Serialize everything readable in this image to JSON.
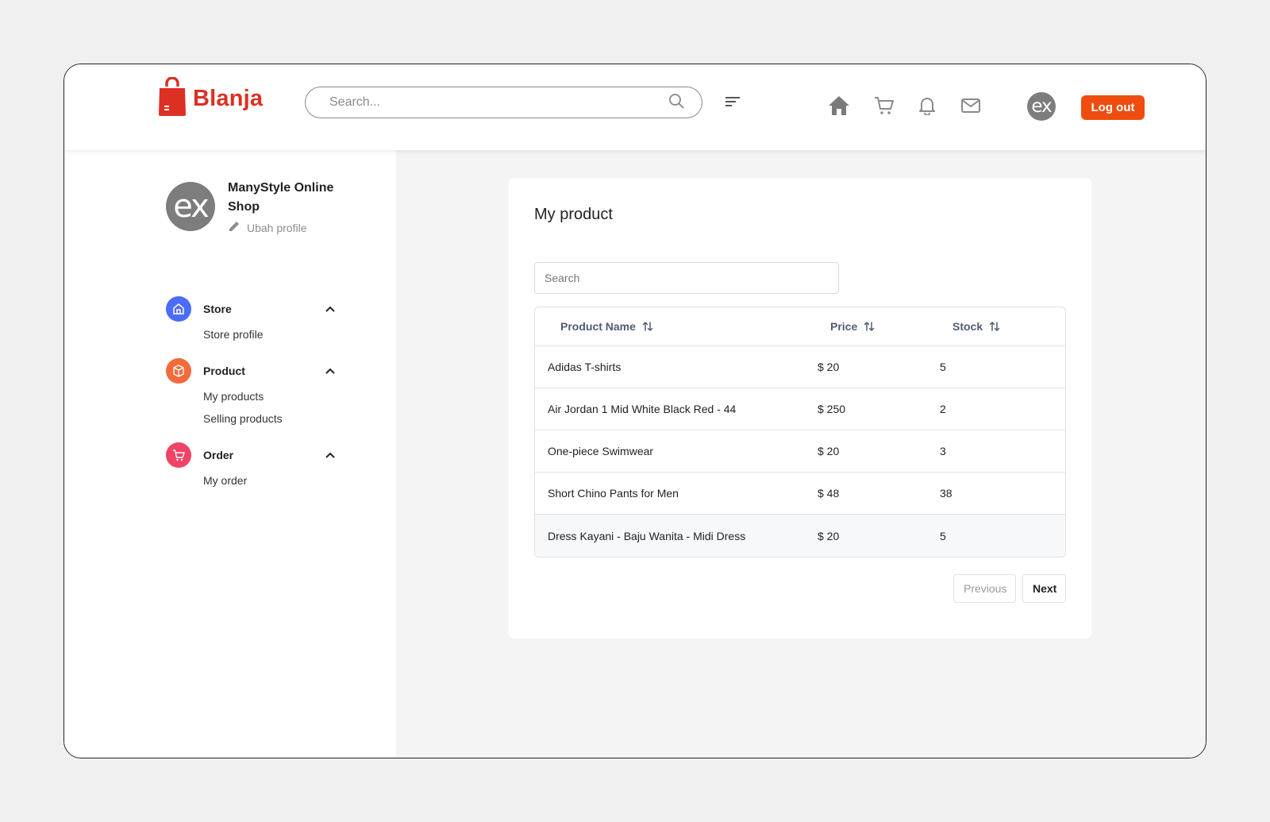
{
  "header": {
    "brand": "Blanja",
    "search_placeholder": "Search...",
    "avatar_text": "ex",
    "logout_label": "Log out",
    "icons": [
      "home-icon",
      "cart-icon",
      "bell-icon",
      "mail-icon"
    ],
    "accent_color": "#db3022",
    "logout_color": "#ee4d0f"
  },
  "sidebar": {
    "avatar_text": "ex",
    "shop_name": "ManyStyle Online Shop",
    "edit_profile_label": "Ubah profile",
    "menu": [
      {
        "label": "Store",
        "icon": "store-icon",
        "color": "#4a6cf7",
        "items": [
          "Store profile"
        ]
      },
      {
        "label": "Product",
        "icon": "box-icon",
        "color": "#f36b3b",
        "items": [
          "My products",
          "Selling products"
        ]
      },
      {
        "label": "Order",
        "icon": "cart-icon",
        "color": "#f04365",
        "items": [
          "My order"
        ]
      }
    ]
  },
  "main": {
    "title": "My product",
    "search_placeholder": "Search",
    "table": {
      "columns": [
        "Product Name",
        "Price",
        "Stock"
      ],
      "rows": [
        {
          "name": "Adidas T-shirts",
          "price": "$ 20",
          "stock": "5"
        },
        {
          "name": "Air Jordan 1 Mid White Black Red - 44",
          "price": "$ 250",
          "stock": "2"
        },
        {
          "name": "One-piece Swimwear",
          "price": "$ 20",
          "stock": "3"
        },
        {
          "name": "Short Chino Pants for Men",
          "price": "$ 48",
          "stock": "38"
        },
        {
          "name": "Dress Kayani - Baju Wanita - Midi Dress",
          "price": "$ 20",
          "stock": "5"
        }
      ]
    },
    "pagination": {
      "previous_label": "Previous",
      "next_label": "Next"
    }
  }
}
